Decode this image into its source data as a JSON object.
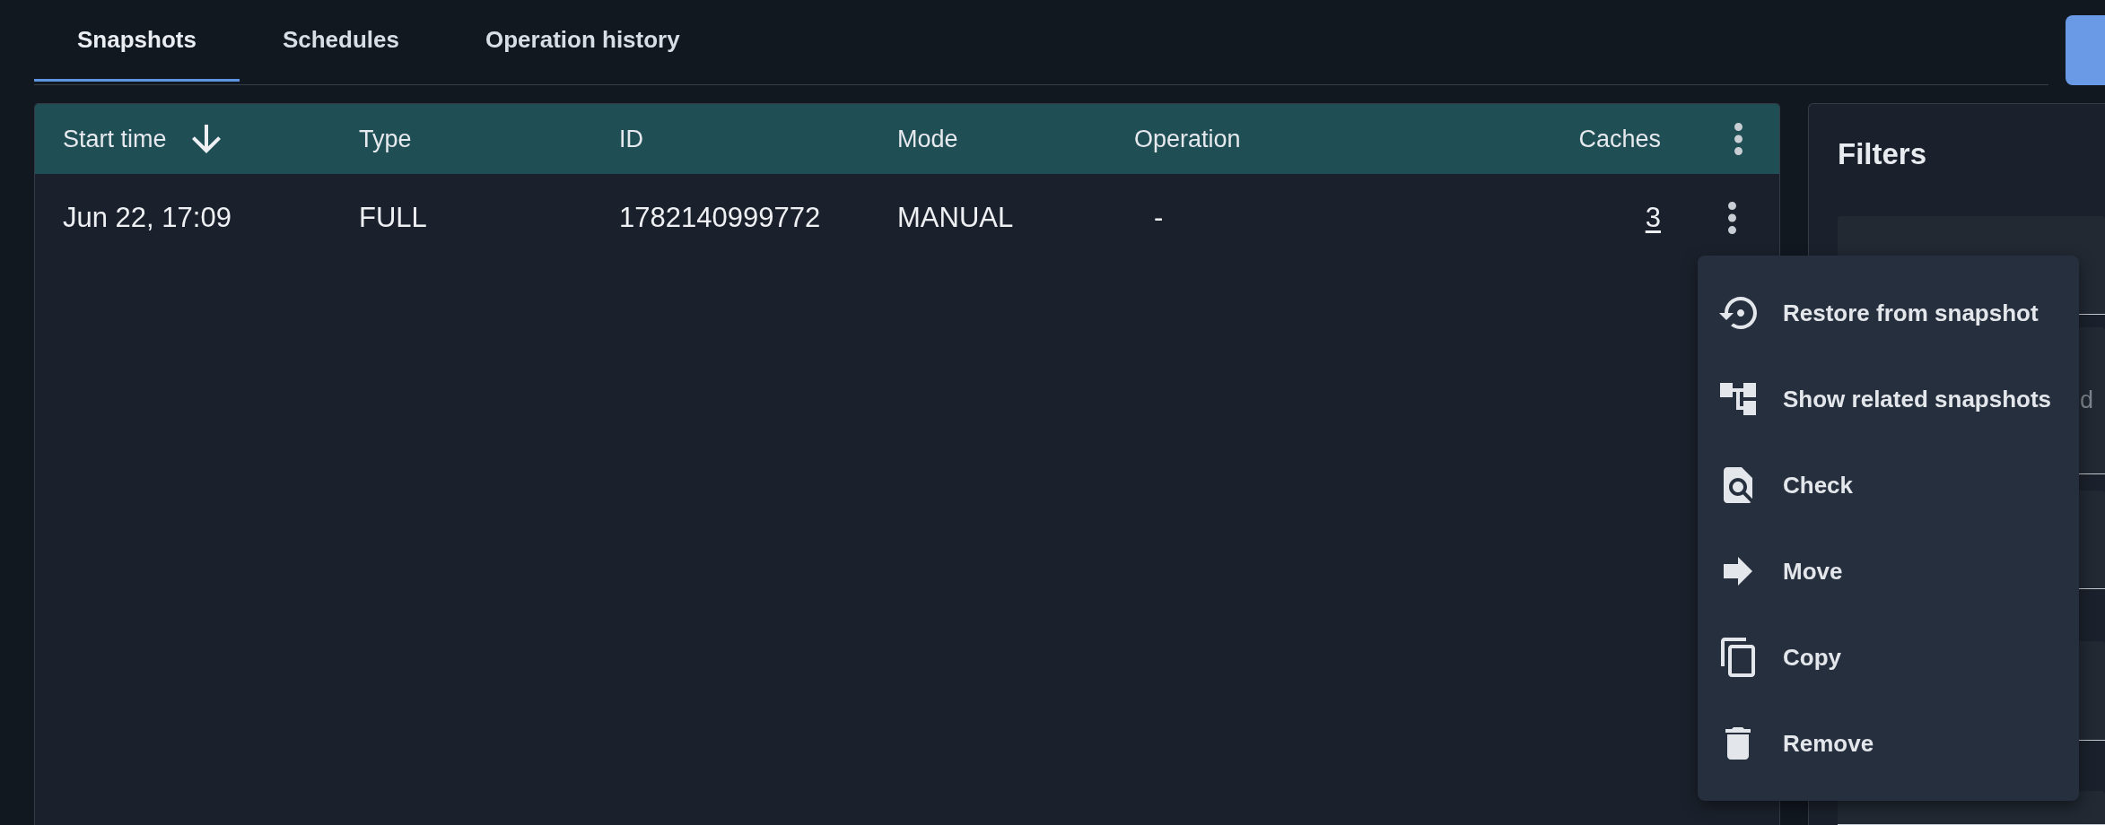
{
  "tabs": [
    {
      "label": "Snapshots",
      "selected": true
    },
    {
      "label": "Schedules",
      "selected": false
    },
    {
      "label": "Operation history",
      "selected": false
    }
  ],
  "table": {
    "columns": [
      {
        "label": "Start time",
        "sorted": true
      },
      {
        "label": "Type",
        "sorted": false
      },
      {
        "label": "ID",
        "sorted": false
      },
      {
        "label": "Mode",
        "sorted": false
      },
      {
        "label": "Operation",
        "sorted": false
      },
      {
        "label": "Caches",
        "sorted": false
      }
    ],
    "rows": [
      {
        "cells": [
          {
            "kind": "text",
            "text": "Jun 22, 17:09"
          },
          {
            "kind": "text",
            "text": "FULL"
          },
          {
            "kind": "text",
            "text": "1782140999772"
          },
          {
            "kind": "text",
            "text": "MANUAL"
          },
          {
            "kind": "text",
            "text": "-"
          },
          {
            "kind": "link",
            "text": "3"
          }
        ]
      }
    ]
  },
  "filters": {
    "title": "Filters",
    "fields": [
      {
        "kind": "input"
      },
      {
        "kind": "input",
        "placeholder": "d"
      },
      {
        "kind": "input"
      },
      {
        "kind": "input"
      },
      {
        "kind": "input"
      }
    ]
  },
  "context_menu": {
    "open": true,
    "items": [
      {
        "kind": "restore",
        "label": "Restore from snapshot"
      },
      {
        "kind": "related",
        "label": "Show related snapshots"
      },
      {
        "kind": "check",
        "label": "Check"
      },
      {
        "kind": "move",
        "label": "Move"
      },
      {
        "kind": "copy",
        "label": "Copy"
      },
      {
        "kind": "remove",
        "label": "Remove"
      }
    ]
  }
}
